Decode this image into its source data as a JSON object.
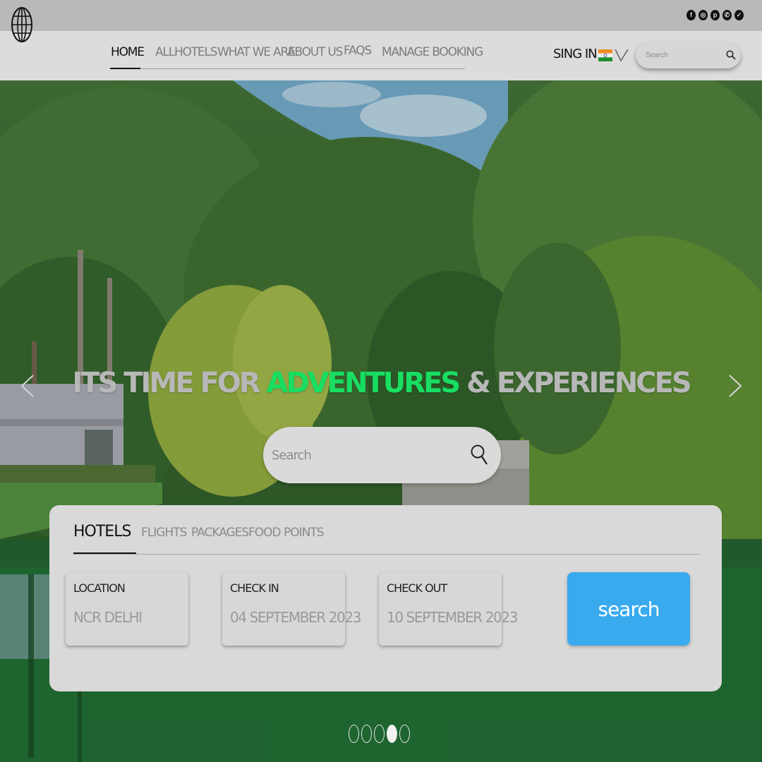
{
  "topbar": {
    "socials": [
      {
        "icon": "facebook-icon",
        "glyph": "f"
      },
      {
        "icon": "instagram-icon",
        "glyph": "◎"
      },
      {
        "icon": "pinterest-icon",
        "glyph": "p"
      },
      {
        "icon": "whatsapp-icon",
        "glyph": "✆"
      },
      {
        "icon": "twitter-icon",
        "glyph": "✓"
      }
    ]
  },
  "nav": {
    "logo_icon": "globe-icon",
    "links": [
      "HOME",
      "ALLHOTELS",
      "WHAT WE ARE",
      "ABOUT US",
      "FAQS",
      "MANAGE BOOKING"
    ],
    "active_index": 0,
    "signin_label": "SING IN",
    "language_icon": "india-flag-icon",
    "search_placeholder": "Search"
  },
  "hero": {
    "headline_pre": "ITS TIME FOR ",
    "headline_accent": "ADVENTURES",
    "headline_post": " & EXPERIENCES",
    "accent_color": "#18de62",
    "search_placeholder": "Search"
  },
  "booking": {
    "tabs": [
      "HOTELS",
      "FLIGHTS",
      "PACKAGES",
      "FOOD POINTS"
    ],
    "active_tab": 0,
    "fields": [
      {
        "label": "LOCATION",
        "value": "NCR DELHI"
      },
      {
        "label": "CHECK IN",
        "value": "04 SEPTEMBER 2023"
      },
      {
        "label": "CHECK OUT",
        "value": "10 SEPTEMBER 2023"
      }
    ],
    "search_button_label": "search",
    "button_color": "#3aaaef"
  },
  "carousel": {
    "slide_count": 5,
    "active_slide": 4
  }
}
